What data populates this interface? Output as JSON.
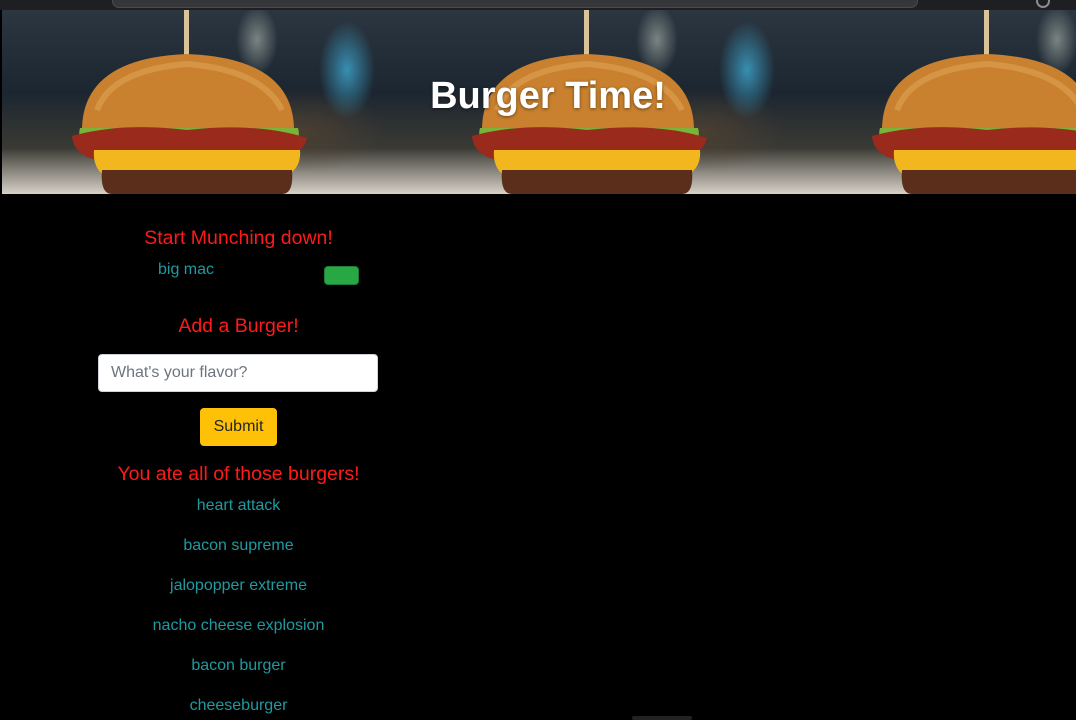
{
  "header": {
    "title": "Burger Time!"
  },
  "uneaten": {
    "heading": "Start Munching down!",
    "items": [
      {
        "name": "big mac",
        "button_color": "#28a745"
      }
    ]
  },
  "add_form": {
    "heading": "Add a Burger!",
    "input_placeholder": "What's your flavor?",
    "input_value": "",
    "submit_label": "Submit",
    "submit_color": "#ffc107"
  },
  "eaten": {
    "heading": "You ate all of those burgers!",
    "items": [
      "heart attack",
      "bacon supreme",
      "jalopopper extreme",
      "nacho cheese explosion",
      "bacon burger",
      "cheeseburger"
    ]
  },
  "colors": {
    "background": "#000000",
    "heading_red": "#ff1a1a",
    "item_teal": "#1f9aa0"
  }
}
